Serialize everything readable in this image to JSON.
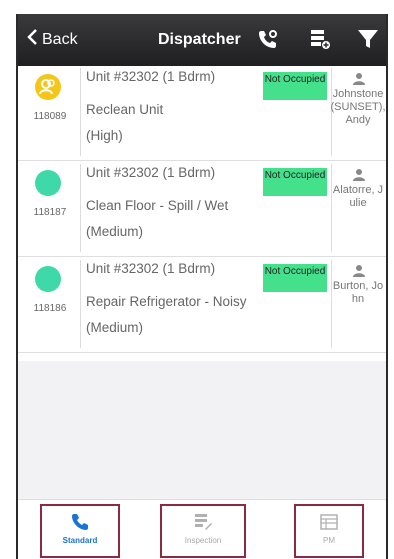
{
  "header": {
    "back_label": "Back",
    "title": "Dispatcher",
    "icons": [
      "phone-settings-icon",
      "server-add-icon",
      "filter-icon"
    ]
  },
  "work_orders": [
    {
      "id": "118089",
      "unit": "Unit #32302 (1 Bdrm)",
      "task": "Reclean Unit",
      "priority": "(High)",
      "status": "Not Occupied",
      "assignee": "Johnstone (SUNSET), Andy",
      "status_color": "#f5c518"
    },
    {
      "id": "118187",
      "unit": "Unit #32302 (1 Bdrm)",
      "task": "Clean Floor - Spill / Wet",
      "priority": "(Medium)",
      "status": "Not Occupied",
      "assignee": "Alatorre, Julie",
      "status_color": "#3fd8a8"
    },
    {
      "id": "118186",
      "unit": "Unit #32302 (1 Bdrm)",
      "task": "Repair Refrigerator - Noisy",
      "priority": "(Medium)",
      "status": "Not Occupied",
      "assignee": "Burton, John",
      "status_color": "#3fd8a8"
    }
  ],
  "tabs": [
    {
      "label": "Standard",
      "icon": "phone-icon",
      "active": true
    },
    {
      "label": "Inspection",
      "icon": "inspection-icon",
      "active": false
    },
    {
      "label": "PM",
      "icon": "pm-icon",
      "active": false
    }
  ],
  "colors": {
    "accent": "#1a73d6",
    "badge": "#44e08c",
    "tab_outline": "#8b2a40"
  }
}
